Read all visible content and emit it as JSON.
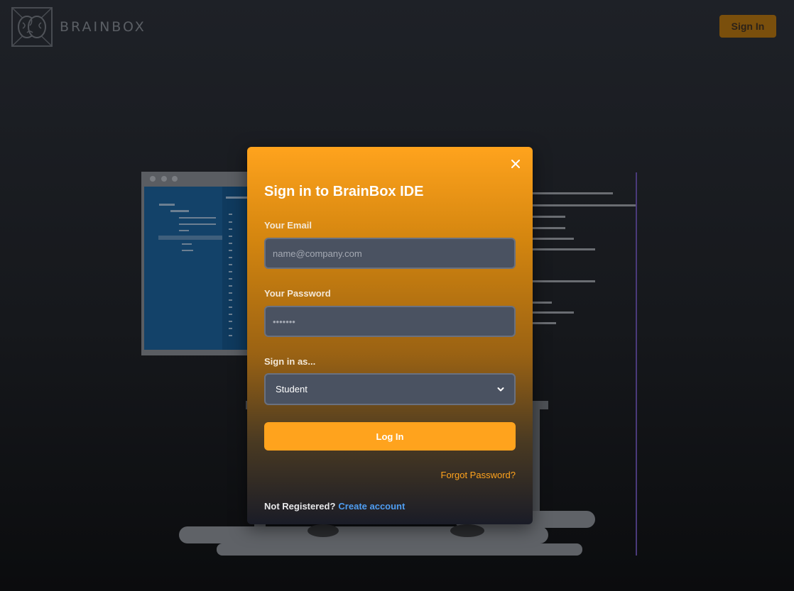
{
  "header": {
    "brand": "BRAINBOX",
    "sign_in_label": "Sign In"
  },
  "modal": {
    "title": "Sign in to BrainBox IDE",
    "email": {
      "label": "Your Email",
      "placeholder": "name@company.com",
      "value": ""
    },
    "password": {
      "label": "Your Password",
      "placeholder": "•••••••",
      "value": ""
    },
    "role": {
      "label": "Sign in as...",
      "selected": "Student"
    },
    "login_label": "Log In",
    "forgot_label": "Forgot Password?",
    "register_prompt": "Not Registered?",
    "create_account_label": "Create account"
  },
  "colors": {
    "accent": "#ffa31d",
    "link": "#4f9ef2",
    "input_bg": "#4a5261"
  },
  "icons": {
    "logo": "brain-icon",
    "close": "close-icon",
    "select": "chevron-down-icon"
  }
}
